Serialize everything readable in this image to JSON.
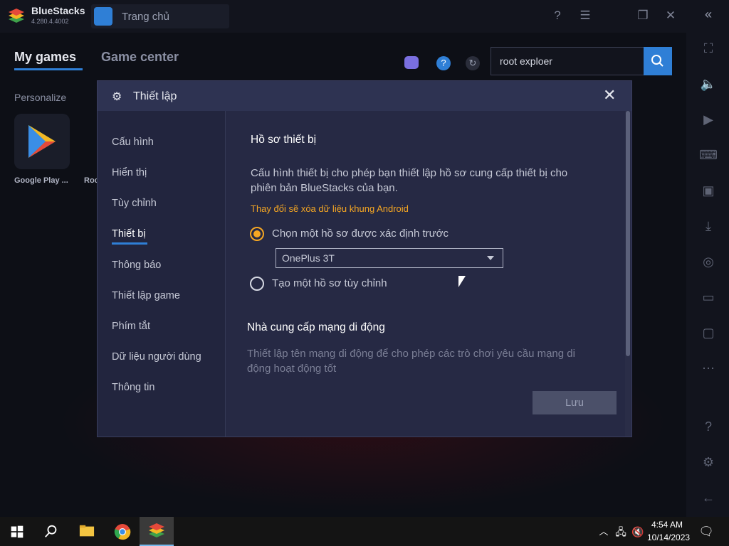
{
  "app": {
    "name": "BlueStacks",
    "version": "4.280.4.4002"
  },
  "top_tab": {
    "label": "Trang chủ"
  },
  "main_tabs": [
    {
      "label": "My games"
    },
    {
      "label": "Game center"
    }
  ],
  "personalize_label": "Personalize",
  "games": [
    {
      "label": "Google Play ..."
    },
    {
      "label": "Roo"
    }
  ],
  "search": {
    "value": "root exploer"
  },
  "dialog": {
    "title": "Thiết lập",
    "nav": [
      {
        "label": "Cấu hình"
      },
      {
        "label": "Hiển thị"
      },
      {
        "label": "Tùy chỉnh"
      },
      {
        "label": "Thiết bị"
      },
      {
        "label": "Thông báo"
      },
      {
        "label": "Thiết lập game"
      },
      {
        "label": "Phím tắt"
      },
      {
        "label": "Dữ liệu người dùng"
      },
      {
        "label": "Thông tin"
      }
    ],
    "active_nav": "Thiết bị",
    "section1_title": "Hồ sơ thiết bị",
    "section1_desc_line1": "Cấu hình thiết bị cho phép bạn thiết lập hồ sơ cung cấp thiết bị cho",
    "section1_desc_line2": "phiên bản BlueStacks của bạn.",
    "warning": "Thay đổi sẽ xóa dữ liệu khung Android",
    "option_predefined": "Chọn một hồ sơ được xác định trước",
    "selected_profile": "OnePlus 3T",
    "option_custom": "Tạo một hồ sơ tùy chỉnh",
    "section2_title": "Nhà cung cấp mạng di động",
    "section2_desc_line1": "Thiết lập tên mạng di động để cho phép các trò chơi yêu cầu mạng di",
    "section2_desc_line2": "động hoạt động tốt",
    "save_label": "Lưu"
  },
  "taskbar": {
    "time": "4:54 AM",
    "date": "10/14/2023"
  },
  "colors": {
    "accent": "#2f7fd6",
    "warning": "#f5a623",
    "dialog_bg": "#262944"
  }
}
